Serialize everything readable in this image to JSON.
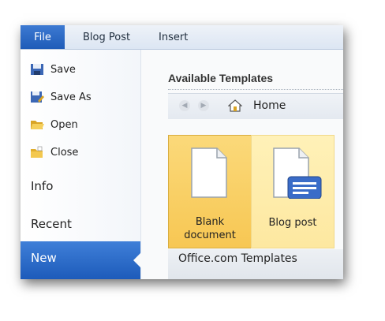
{
  "tabs": [
    {
      "label": "File"
    },
    {
      "label": "Blog Post"
    },
    {
      "label": "Insert"
    }
  ],
  "sidebar": {
    "commands": [
      {
        "label": "Save",
        "icon": "save-icon"
      },
      {
        "label": "Save As",
        "icon": "save-as-icon"
      },
      {
        "label": "Open",
        "icon": "open-folder-icon"
      },
      {
        "label": "Close",
        "icon": "close-folder-icon"
      }
    ],
    "sections": [
      {
        "label": "Info"
      },
      {
        "label": "Recent"
      },
      {
        "label": "New",
        "selected": true
      }
    ]
  },
  "main": {
    "heading": "Available Templates",
    "nav": {
      "home_label": "Home"
    },
    "templates": [
      {
        "line1": "Blank",
        "line2": "document",
        "selected": true
      },
      {
        "line1": "Blog post",
        "line2": ""
      }
    ],
    "office_label": "Office.com Templates"
  },
  "colors": {
    "accent": "#1f5cb8",
    "tile_selected": "#f7c753",
    "tile_hover": "#fde8a0"
  }
}
